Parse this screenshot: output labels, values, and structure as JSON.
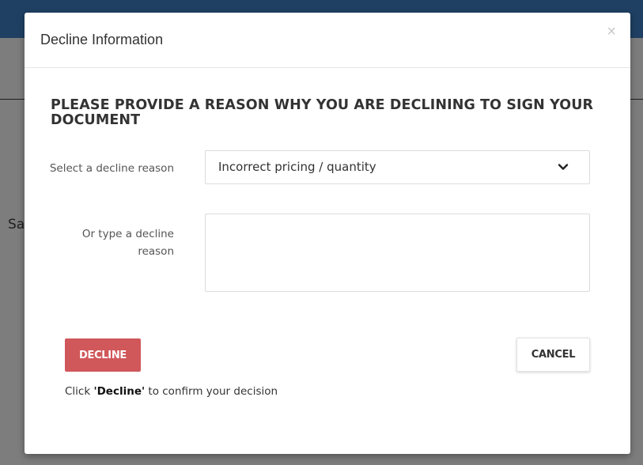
{
  "background": {
    "partial_text": "Sa"
  },
  "modal": {
    "title": "Decline Information",
    "close_glyph": "×",
    "heading": "PLEASE PROVIDE A REASON WHY YOU ARE DECLINING TO SIGN YOUR DOCUMENT",
    "select_label": "Select a decline reason",
    "select_value": "Incorrect pricing / quantity",
    "textarea_label": "Or type a decline reason",
    "textarea_value": "",
    "decline_label": "DECLINE",
    "cancel_label": "CANCEL",
    "hint": {
      "prefix": "Click ",
      "emphasis": "'Decline'",
      "suffix": " to confirm your decision"
    }
  },
  "colors": {
    "topbar": "#1f4063",
    "decline_button": "#d0575a",
    "overlay_page": "#7d7d7d"
  },
  "icons": {
    "close": "close-icon",
    "select_arrow": "chevron-down-icon"
  }
}
